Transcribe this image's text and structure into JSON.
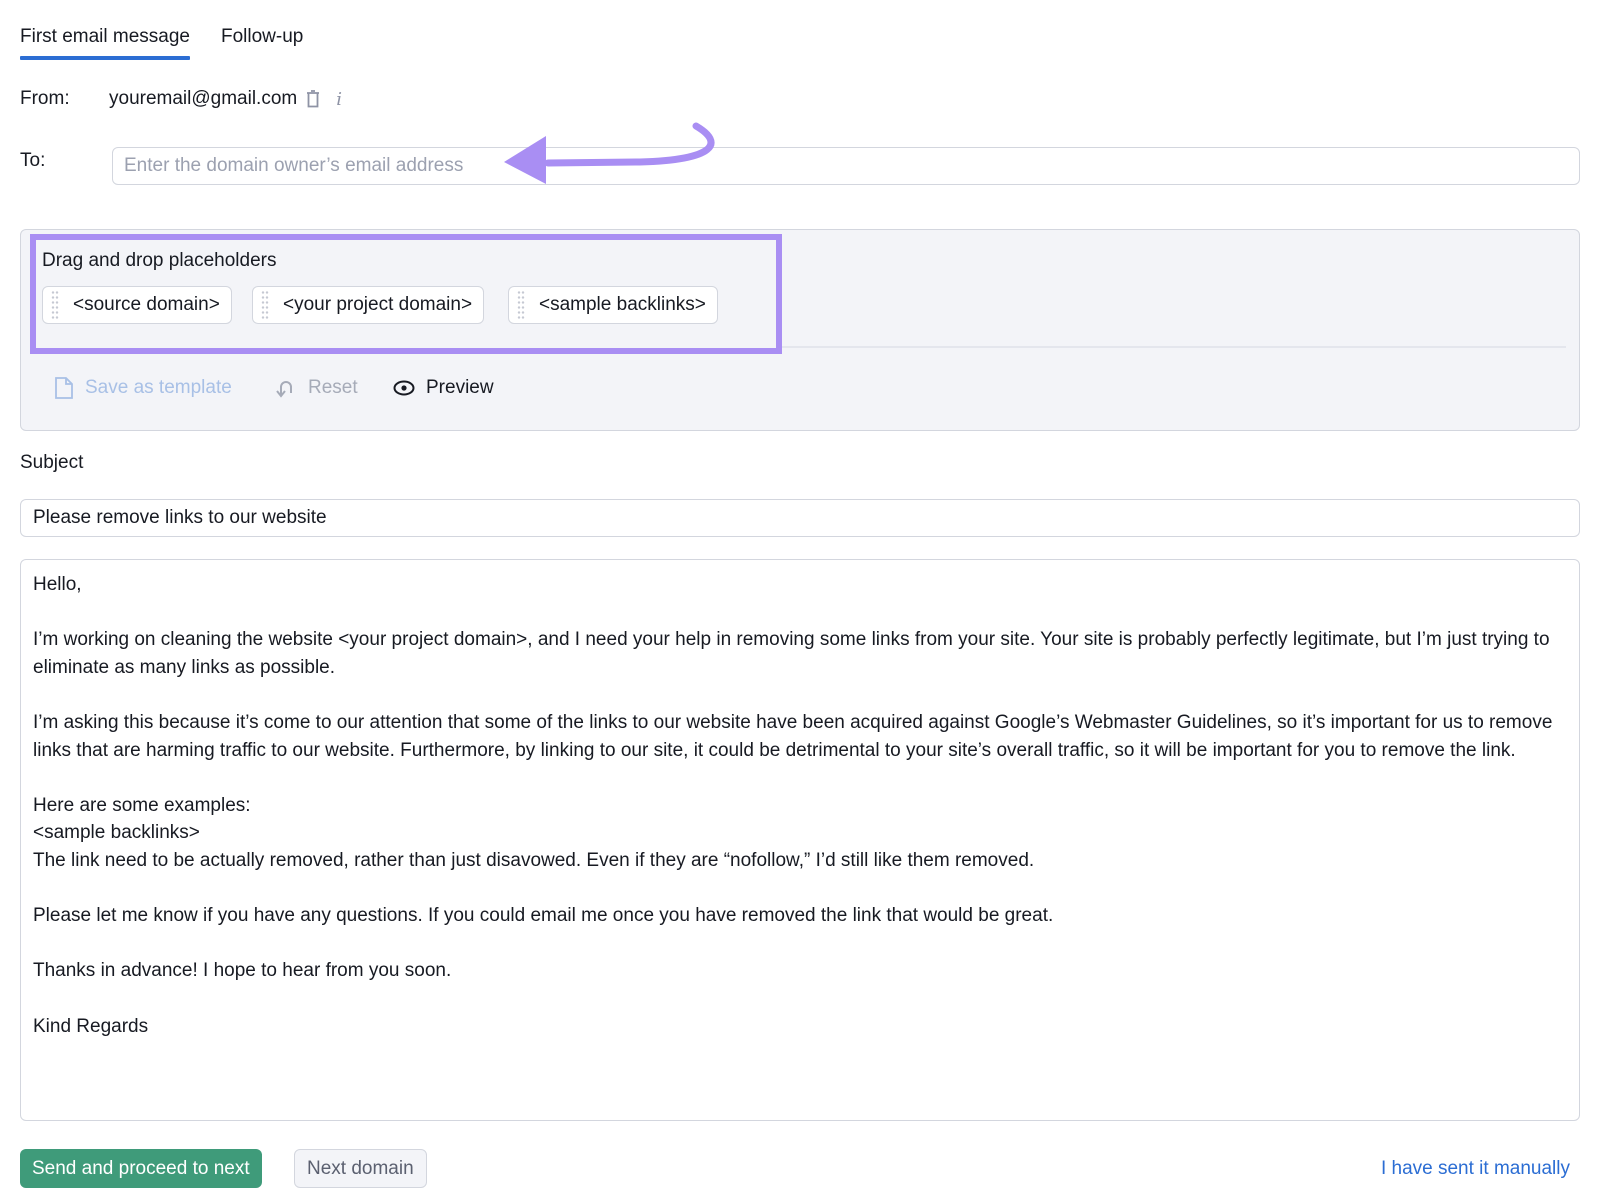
{
  "tabs": [
    {
      "label": "First email message",
      "active": true
    },
    {
      "label": "Follow-up",
      "active": false
    }
  ],
  "from": {
    "label": "From:",
    "value": "youremail@gmail.com",
    "icons": [
      "trash-icon",
      "info-icon"
    ]
  },
  "to": {
    "label": "To:",
    "value": "",
    "placeholder": "Enter the domain owner’s email address"
  },
  "placeholders": {
    "title": "Drag and drop placeholders",
    "chips": [
      "<source domain>",
      "<your project domain>",
      "<sample backlinks>"
    ],
    "highlight_color": "#a98ef3"
  },
  "actions": {
    "save_template": "Save as template",
    "reset": "Reset",
    "preview": "Preview"
  },
  "subject": {
    "label": "Subject",
    "value": "Please remove links to our website"
  },
  "body": {
    "paragraphs": [
      "Hello,",
      "",
      "I’m working on cleaning the website <your project domain>, and I need your help in removing some links from your site. Your site is probably perfectly legitimate, but I’m just trying to eliminate as many links as possible.",
      "",
      "I’m asking this because it’s come to our attention that some of the links to our website have been acquired against Google’s Webmaster Guidelines, so it’s important for us to remove links that are harming traffic to our website. Furthermore, by linking to our site, it could be detrimental to your site’s overall traffic, so it will be important for you to remove the link.",
      "",
      "Here are some examples:",
      "<sample backlinks>",
      "The link need to be actually removed, rather than just disavowed. Even if they are “nofollow,” I’d still like them removed.",
      "",
      "Please let me know if you have any questions. If you could email me once you have removed the link that would be great.",
      "",
      "Thanks in advance! I hope to hear from you soon.",
      "",
      "Kind Regards"
    ]
  },
  "footer": {
    "send_button": "Send and proceed to next",
    "next_button": "Next domain",
    "manual_link": "I have sent it manually"
  },
  "colors": {
    "accent_blue": "#2b6dd3",
    "primary_green": "#3f9b7a",
    "annotation_purple": "#a98ef3"
  }
}
